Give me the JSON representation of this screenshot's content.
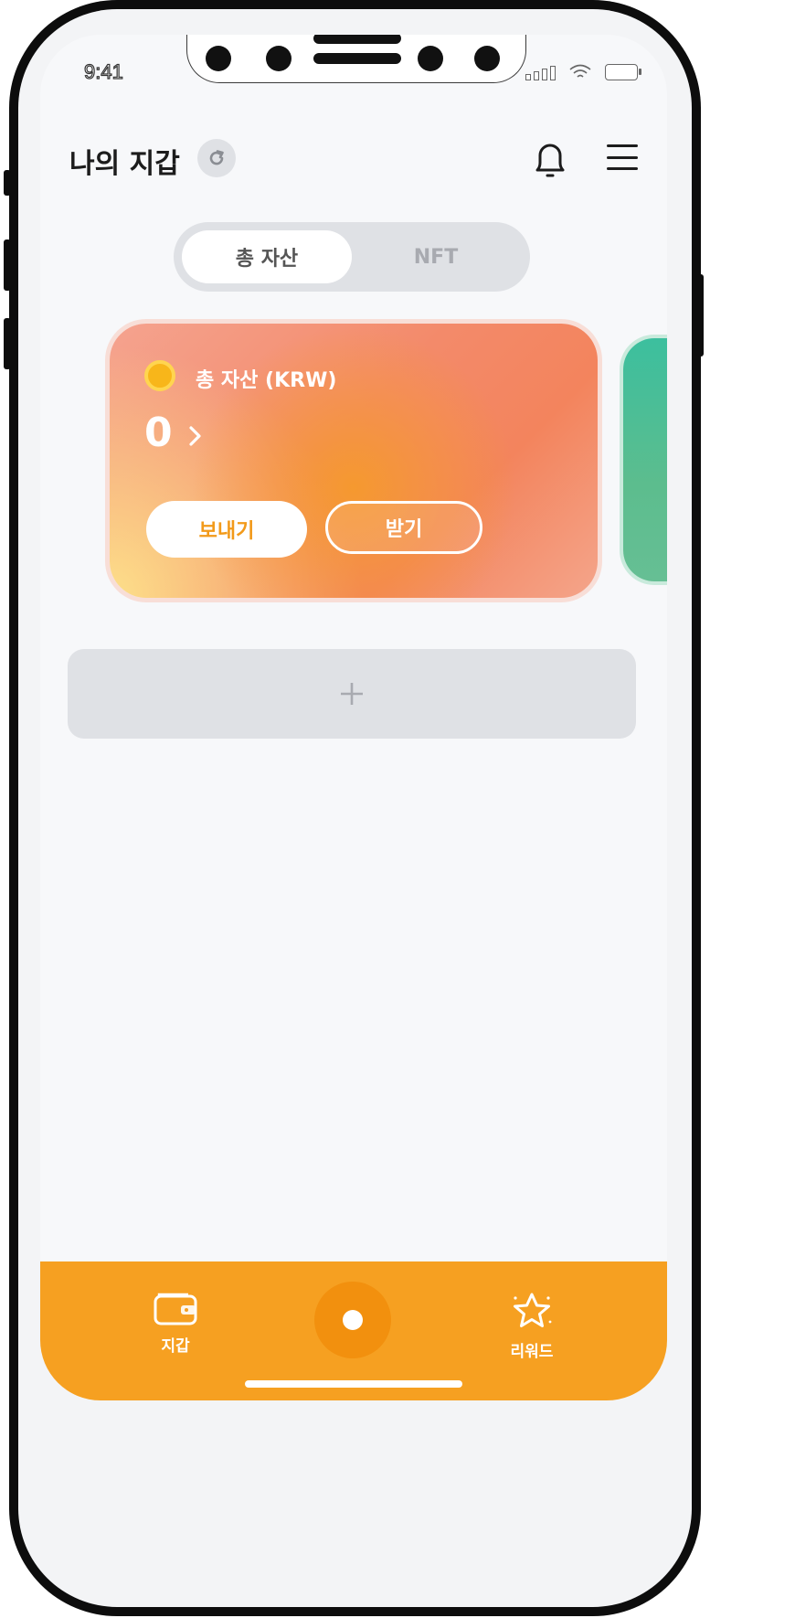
{
  "status_bar": {
    "time": "9:41"
  },
  "header": {
    "title": "나의 지갑",
    "icons": [
      "refresh-icon",
      "bell-icon",
      "hamburger-menu-icon"
    ]
  },
  "segment": {
    "tabs": [
      {
        "label": "총 자산",
        "active": true
      },
      {
        "label": "NFT",
        "active": false
      }
    ]
  },
  "asset_card": {
    "label": "총 자산 (KRW)",
    "value": "0",
    "send_label": "보내기",
    "receive_label": "받기",
    "icon": "coin-icon"
  },
  "add_card": {
    "icon": "plus-icon"
  },
  "bottom_nav": {
    "items": [
      {
        "label": "지갑",
        "icon": "wallet-icon"
      },
      {
        "label": "",
        "icon": "home-dot-icon"
      },
      {
        "label": "리워드",
        "icon": "star-icon"
      }
    ]
  },
  "colors": {
    "accent": "#f6a021",
    "accent_dark": "#f2900e",
    "background": "#f7f8fa",
    "card_gradient": [
      "#f5a38f",
      "#f5992f",
      "#fde08a"
    ],
    "peek_card": "#3cbf9e",
    "text_dark": "#1c1c1c"
  }
}
